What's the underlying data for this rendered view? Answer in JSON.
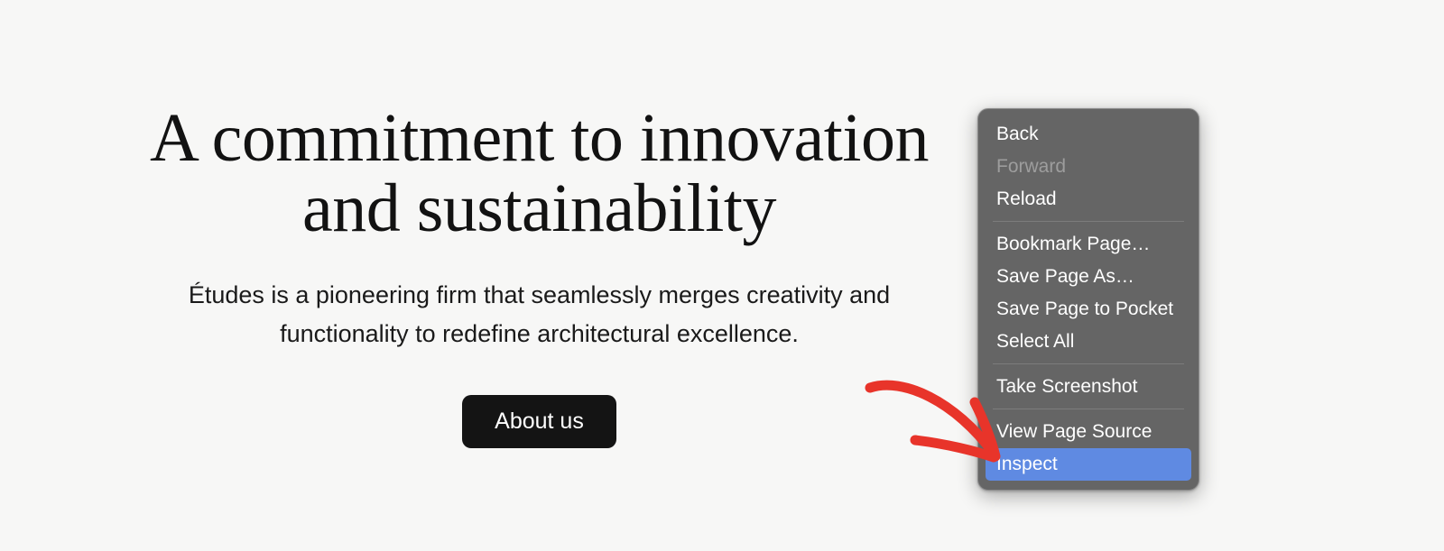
{
  "page": {
    "background_color": "#f7f7f6",
    "hero": {
      "title": "A commitment to innovation and sustainability",
      "subtitle": "Études is a pioneering firm that seamlessly merges creativity and functionality to redefine architectural excellence.",
      "button_label": "About us",
      "button_color": "#141414",
      "text_color": "#121212"
    }
  },
  "context_menu": {
    "background_color": "#656565",
    "selected_color": "#5f8ae2",
    "disabled_color": "#9d9d9d",
    "groups": [
      {
        "items": [
          {
            "label": "Back",
            "state": "enabled"
          },
          {
            "label": "Forward",
            "state": "disabled"
          },
          {
            "label": "Reload",
            "state": "enabled"
          }
        ]
      },
      {
        "items": [
          {
            "label": "Bookmark Page…",
            "state": "enabled"
          },
          {
            "label": "Save Page As…",
            "state": "enabled"
          },
          {
            "label": "Save Page to Pocket",
            "state": "enabled"
          },
          {
            "label": "Select All",
            "state": "enabled"
          }
        ]
      },
      {
        "items": [
          {
            "label": "Take Screenshot",
            "state": "enabled"
          }
        ]
      },
      {
        "items": [
          {
            "label": "View Page Source",
            "state": "enabled"
          },
          {
            "label": "Inspect",
            "state": "selected"
          }
        ]
      }
    ]
  },
  "annotation": {
    "type": "hand-drawn-arrow",
    "color": "#e8342a",
    "points_to": "Inspect"
  }
}
